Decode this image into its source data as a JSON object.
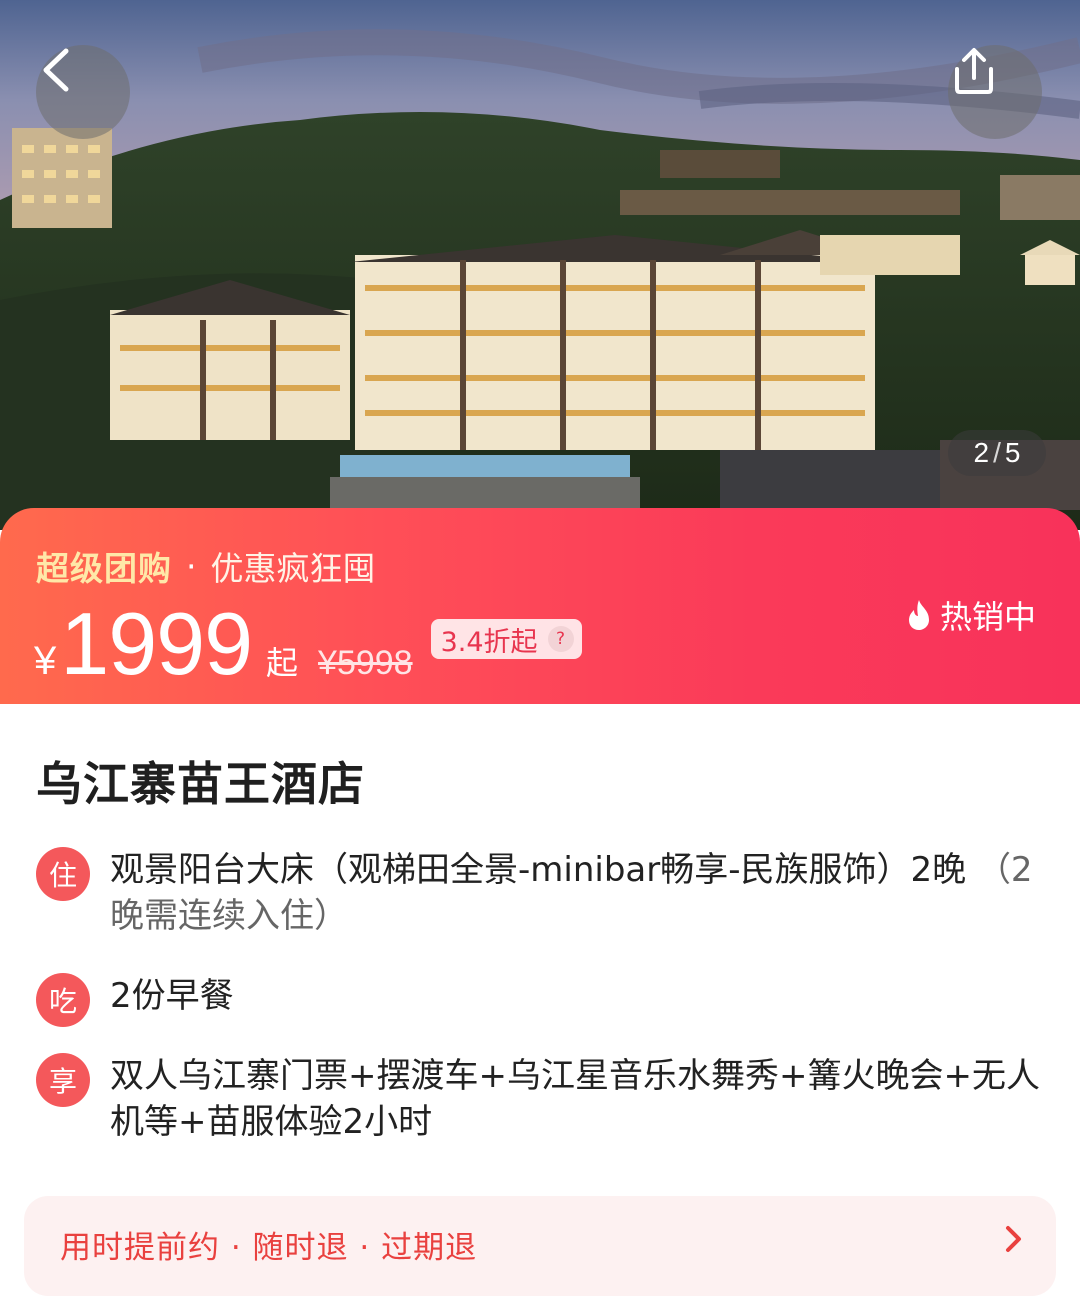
{
  "hero": {
    "pager_current": "2",
    "pager_separator": "/",
    "pager_total": "5",
    "icons": {
      "back": "chevron-left-icon",
      "share": "share-icon"
    }
  },
  "price": {
    "promo_tag": "超级团购",
    "promo_dot": "·",
    "promo_text": "优惠疯狂囤",
    "currency": "¥",
    "amount": "1999",
    "from": "起",
    "original": "¥5998",
    "discount": "3.4折起",
    "help": "?",
    "hot": "热销中",
    "colors": {
      "gradient_start": "#ff6a4d",
      "gradient_end": "#f8325a",
      "promo_tag": "#ffe8a8"
    }
  },
  "hotel": {
    "name": "乌江寨苗王酒店"
  },
  "features": [
    {
      "badge": "住",
      "text": "观景阳台大床（观梯田全景-minibar畅享-民族服饰）2晚",
      "note": "（2晚需连续入住）"
    },
    {
      "badge": "吃",
      "text": "2份早餐"
    },
    {
      "badge": "享",
      "text": "双人乌江寨门票+摆渡车+乌江星音乐水舞秀+篝火晚会+无人机等+苗服体验2小时"
    }
  ],
  "policy": {
    "text": "用时提前约 · 随时退 · 过期退",
    "accent": "#e9413f"
  }
}
